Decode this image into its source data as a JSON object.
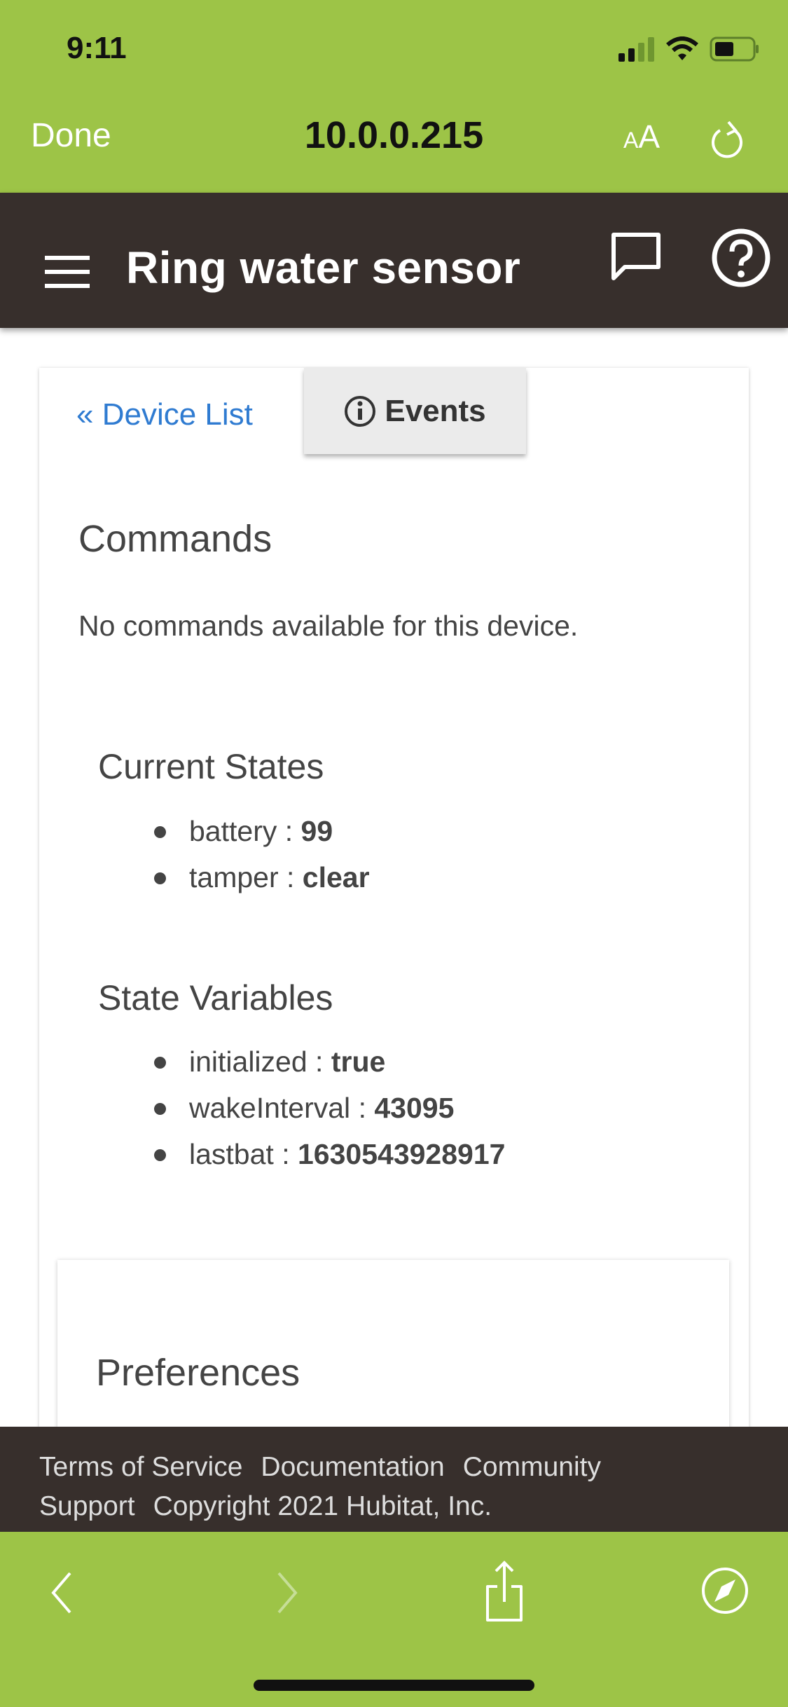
{
  "status_bar": {
    "time": "9:11",
    "icons": [
      "cellular-signal-icon",
      "wifi-icon",
      "battery-icon"
    ]
  },
  "browser": {
    "done_label": "Done",
    "url": "10.0.0.215",
    "text_size_label_small": "A",
    "text_size_label": "A",
    "reload_icon": "reload-icon"
  },
  "header": {
    "title": "Ring water sensor",
    "icons": [
      "menu-icon",
      "chat-icon",
      "help-icon"
    ]
  },
  "nav": {
    "device_list": "« Device List",
    "events": "Events"
  },
  "commands": {
    "title": "Commands",
    "empty": "No commands available for this device."
  },
  "current_states": {
    "title": "Current States",
    "items": [
      {
        "key": "battery",
        "value": "99"
      },
      {
        "key": "tamper",
        "value": "clear"
      }
    ]
  },
  "state_variables": {
    "title": "State Variables",
    "items": [
      {
        "key": "initialized",
        "value": "true"
      },
      {
        "key": "wakeInterval",
        "value": "43095"
      },
      {
        "key": "lastbat",
        "value": "1630543928917"
      }
    ]
  },
  "preferences": {
    "title": "Preferences"
  },
  "footer": {
    "links": [
      "Terms of Service",
      "Documentation",
      "Community",
      "Support"
    ],
    "copyright": "Copyright 2021 Hubitat, Inc."
  },
  "colors": {
    "browser_green": "#9dc447",
    "header_dark": "#372f2c",
    "link_blue": "#2f7bd1"
  }
}
